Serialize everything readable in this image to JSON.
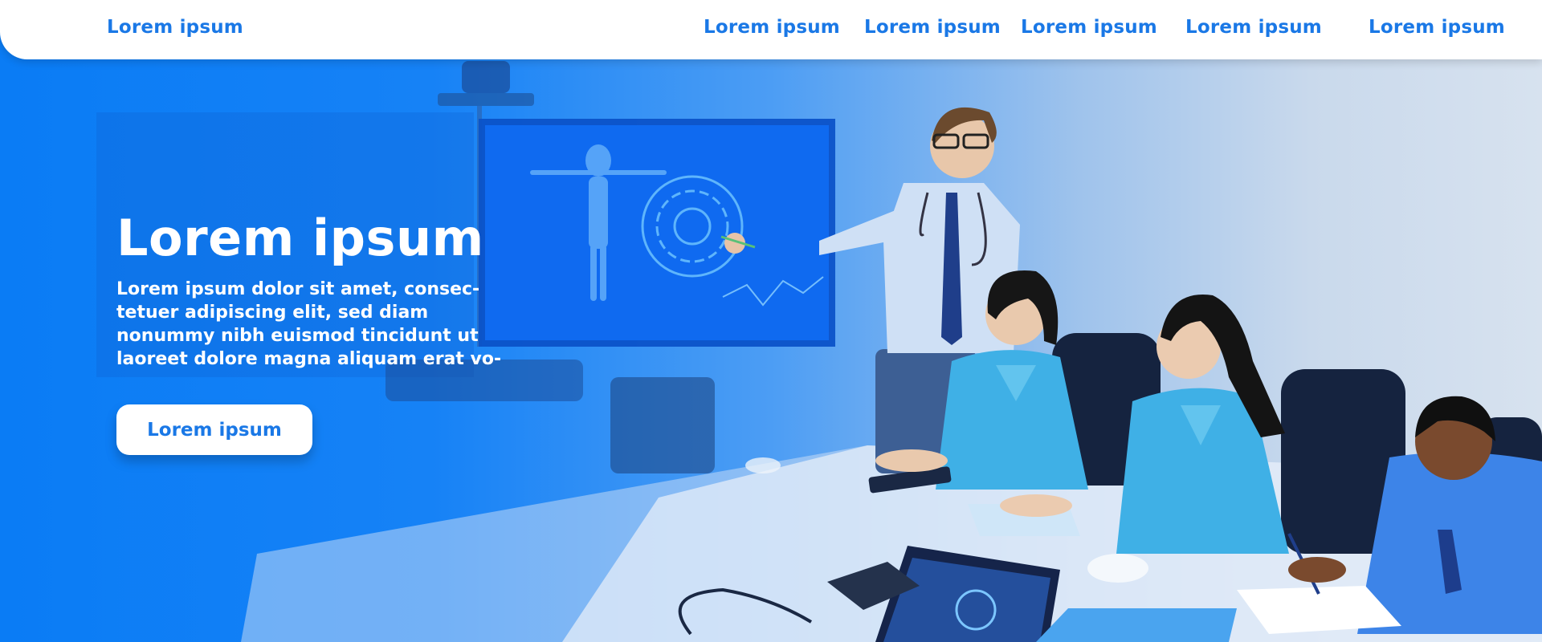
{
  "nav": {
    "brand": "Lorem ipsum",
    "links": [
      "Lorem ipsum",
      "Lorem ipsum",
      "Lorem ipsum",
      "Lorem ipsum",
      "Lorem ipsum"
    ]
  },
  "hero": {
    "title": "Lorem ipsum",
    "text_lines": [
      "Lorem ipsum dolor sit amet, consec-",
      "tetuer adipiscing elit, sed diam",
      "nonummy nibh euismod tincidunt ut",
      "laoreet dolore magna aliquam erat vo-"
    ],
    "button_label": "Lorem ipsum"
  },
  "colors": {
    "accent": "#1a78e6",
    "hero_blue": "#0a7cf5",
    "scrubs": "#3fb0e6",
    "white": "#ffffff"
  }
}
